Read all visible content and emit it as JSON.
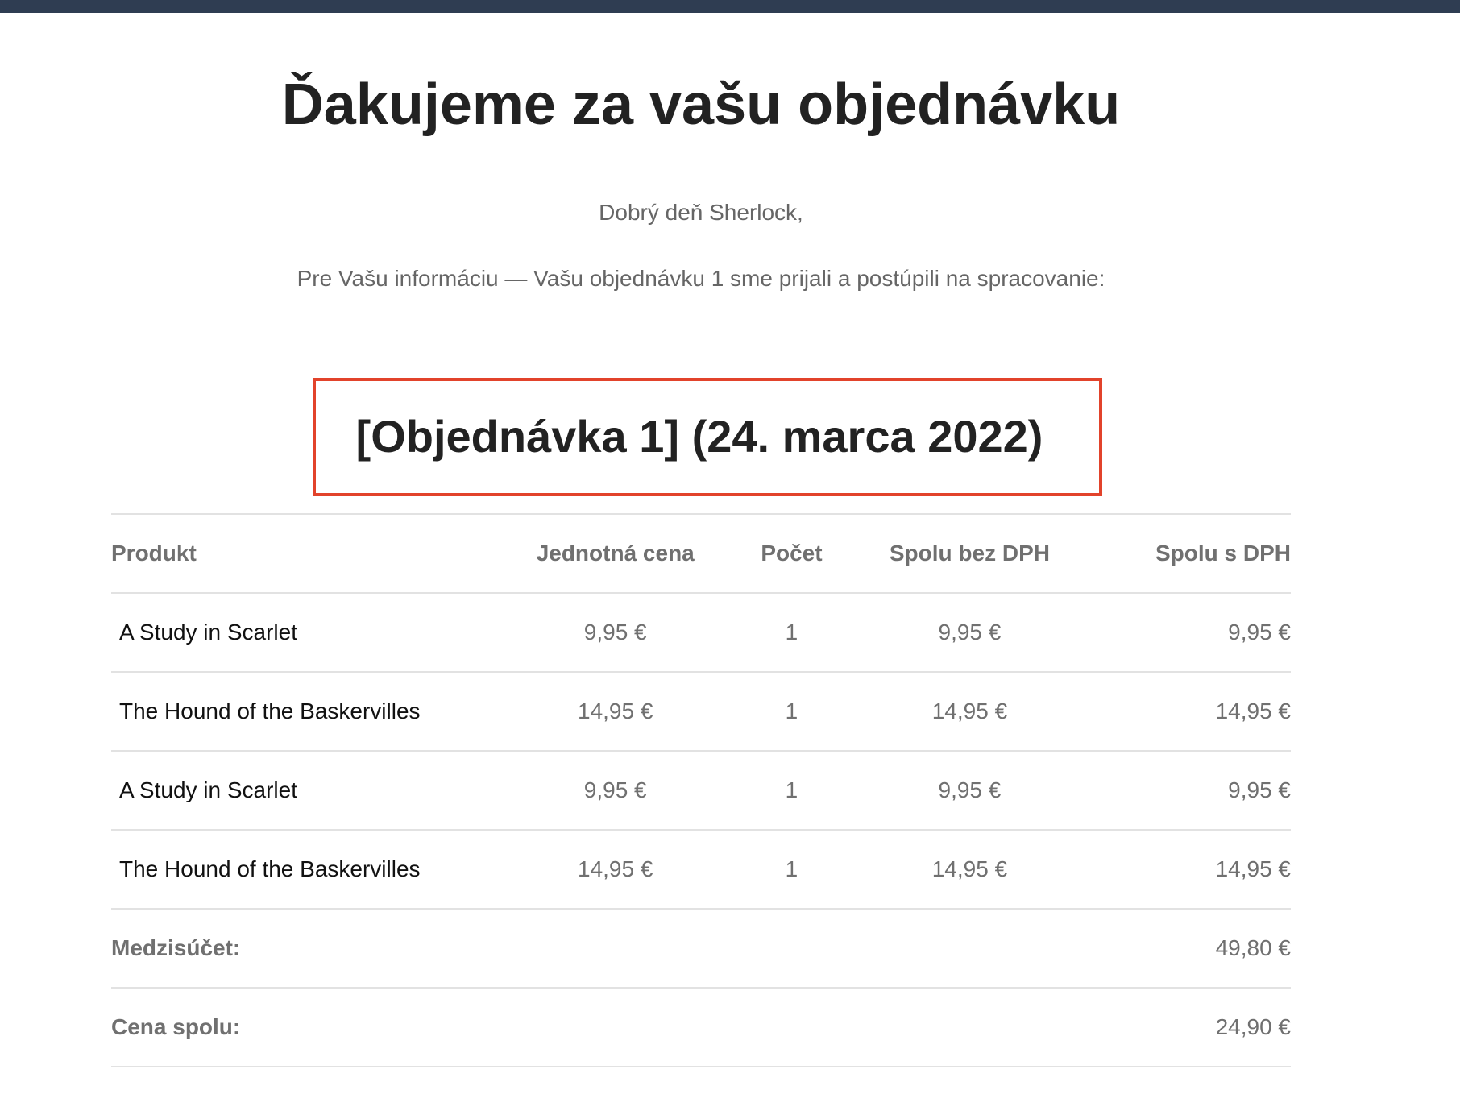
{
  "email": {
    "title": "Ďakujeme za vašu objednávku",
    "greeting": "Dobrý deň Sherlock,",
    "intro": "Pre Vašu informáciu — Vašu objednávku 1 sme prijali a postúpili na spracovanie:",
    "order_heading": "[Objednávka 1] (24. marca 2022)",
    "colors": {
      "header_bar": "#2f3d52",
      "highlight_border": "#e2432b",
      "heading_text": "#222222",
      "muted_text": "#707070"
    }
  },
  "table": {
    "headers": {
      "product": "Produkt",
      "unit_price": "Jednotná cena",
      "quantity": "Počet",
      "total_excl_vat": "Spolu bez DPH",
      "total_incl_vat": "Spolu s DPH"
    },
    "rows": [
      {
        "product": "A Study in Scarlet",
        "unit_price": "9,95 €",
        "quantity": "1",
        "total_excl_vat": "9,95 €",
        "total_incl_vat": "9,95 €"
      },
      {
        "product": "The Hound of the Baskervilles",
        "unit_price": "14,95 €",
        "quantity": "1",
        "total_excl_vat": "14,95 €",
        "total_incl_vat": "14,95 €"
      },
      {
        "product": "A Study in Scarlet",
        "unit_price": "9,95 €",
        "quantity": "1",
        "total_excl_vat": "9,95 €",
        "total_incl_vat": "9,95 €"
      },
      {
        "product": "The Hound of the Baskervilles",
        "unit_price": "14,95 €",
        "quantity": "1",
        "total_excl_vat": "14,95 €",
        "total_incl_vat": "14,95 €"
      }
    ],
    "totals": [
      {
        "label": "Medzisúčet:",
        "value": "49,80 €"
      },
      {
        "label": "Cena spolu:",
        "value": "24,90 €"
      }
    ]
  }
}
